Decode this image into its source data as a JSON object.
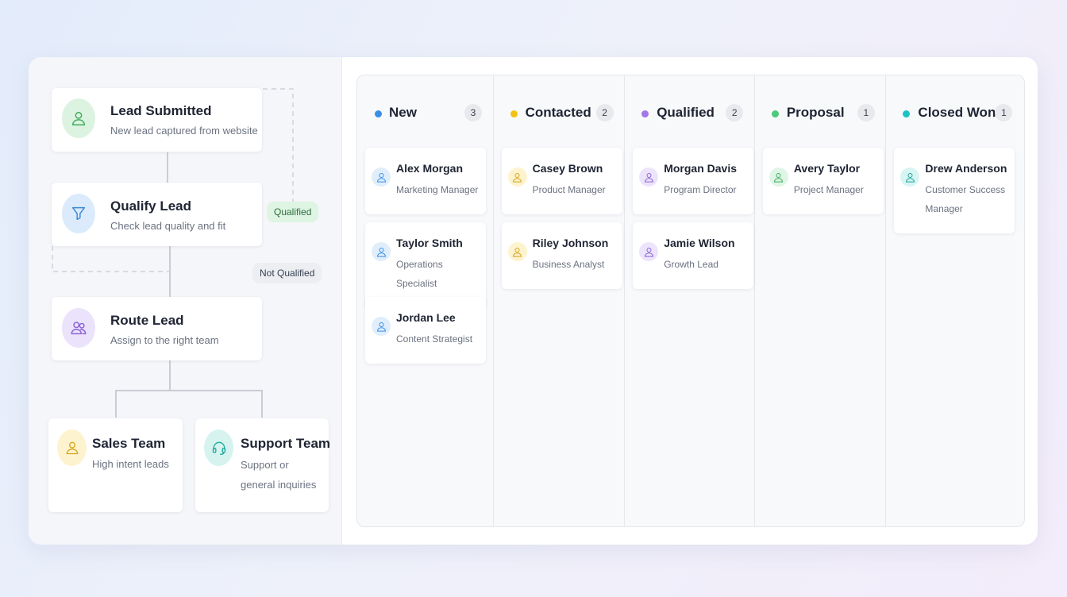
{
  "workflow": {
    "steps": [
      {
        "title": "Lead Submitted",
        "desc": "New lead captured from website",
        "icon": "user-icon",
        "color": "#3fae5d",
        "bg": "#dcf3e1"
      },
      {
        "title": "Qualify Lead",
        "desc": "Check lead quality and fit",
        "icon": "filter-icon",
        "color": "#3a8ad6",
        "bg": "#dcebfb"
      },
      {
        "title": "Route Lead",
        "desc": "Assign to the right team",
        "icon": "users-icon",
        "color": "#8b63d9",
        "bg": "#ebe2fb"
      }
    ],
    "branches": [
      {
        "title": "Sales Team",
        "desc": "High intent leads",
        "icon": "user-icon",
        "color": "#d9a418",
        "bg": "#fdf3cf"
      },
      {
        "title": "Support Team",
        "desc": "Support or general inquiries",
        "icon": "headset-icon",
        "color": "#1ba89a",
        "bg": "#d6f3ef"
      }
    ],
    "labels": {
      "qualified": "Qualified",
      "not_qualified": "Not Qualified"
    }
  },
  "pipeline": {
    "columns": [
      {
        "title": "New",
        "count": "3",
        "color": "#3a8ee6",
        "avatar_bg": "#e0eefc",
        "avatar_color": "#3a8ee6",
        "cards": [
          {
            "name": "Alex Morgan",
            "role": "Marketing Manager"
          },
          {
            "name": "Taylor Smith",
            "role": "Operations Specialist"
          },
          {
            "name": "Jordan Lee",
            "role": "Content Strategist"
          }
        ]
      },
      {
        "title": "Contacted",
        "count": "2",
        "color": "#f2c214",
        "avatar_bg": "#fdf3cf",
        "avatar_color": "#d9a418",
        "cards": [
          {
            "name": "Casey Brown",
            "role": "Product Manager"
          },
          {
            "name": "Riley Johnson",
            "role": "Business Analyst"
          }
        ]
      },
      {
        "title": "Qualified",
        "count": "2",
        "color": "#a277e6",
        "avatar_bg": "#ede4fb",
        "avatar_color": "#8b63d9",
        "cards": [
          {
            "name": "Morgan Davis",
            "role": "Program Director"
          },
          {
            "name": "Jamie Wilson",
            "role": "Growth Lead"
          }
        ]
      },
      {
        "title": "Proposal",
        "count": "1",
        "color": "#4cc97a",
        "avatar_bg": "#dff5e6",
        "avatar_color": "#3fae5d",
        "cards": [
          {
            "name": "Avery Taylor",
            "role": "Project Manager"
          }
        ]
      },
      {
        "title": "Closed Won",
        "count": "1",
        "color": "#1fc2c2",
        "avatar_bg": "#d8f4f3",
        "avatar_color": "#1ba89a",
        "cards": [
          {
            "name": "Drew Anderson",
            "role": "Customer Success Manager"
          }
        ]
      }
    ]
  }
}
